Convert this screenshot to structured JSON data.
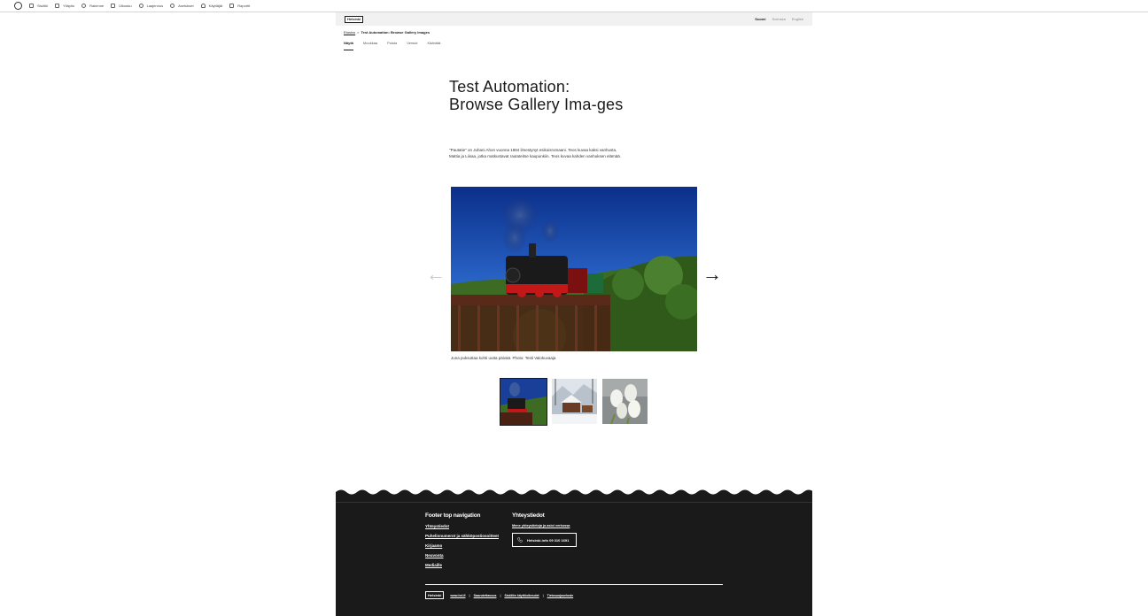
{
  "admin_bar": {
    "items": [
      {
        "label": "Sisältö",
        "icon": "content-icon"
      },
      {
        "label": "Ylläpito",
        "icon": "structure-icon"
      },
      {
        "label": "Rakenne",
        "icon": "gear-icon"
      },
      {
        "label": "Ulkoasu",
        "icon": "appearance-icon"
      },
      {
        "label": "Laajennus",
        "icon": "extend-icon"
      },
      {
        "label": "Asetukset",
        "icon": "config-icon"
      },
      {
        "label": "Käyttäjät",
        "icon": "people-icon"
      },
      {
        "label": "Raportit",
        "icon": "reports-icon"
      }
    ]
  },
  "header": {
    "logo": "Helsinki",
    "languages": [
      "Suomi",
      "Svenska",
      "English"
    ],
    "active_language": "Suomi"
  },
  "breadcrumb": {
    "home": "Etusivu",
    "separator": ">",
    "current": "Test Automation: Browse Gallery Images"
  },
  "local_tabs": [
    "Näytä",
    "Muokkaa",
    "Poista",
    "Versiot",
    "Kääntää"
  ],
  "page": {
    "title": "Test Automation: Browse Gallery Ima-ges",
    "lead": "\"Pautatie\" on Juhani Ahon vuonna 1884 ilmestynyt esikoisromaani. Teos kuvaa kaksi vanhusta, Mattia ja Liisaa, jotka matkustavat rautateitse kaupunkiin. Teos kuvaa kahden vanhuksen elämää."
  },
  "gallery": {
    "caption": "Juna puksuttaa kohti uutta päivää. Photo: Testi Valokuvaaja",
    "prev_label": "←",
    "next_label": "→",
    "thumbnails": [
      "train",
      "winter-village",
      "tulips"
    ],
    "active_index": 0
  },
  "footer": {
    "nav_heading": "Footer top navigation",
    "nav_links": [
      "Yhteystiedot",
      "Puhelinnumerot ja sähköpostiosoitteet",
      "Kirjaamo",
      "Neuvonta",
      "Mediaille"
    ],
    "contact_heading": "Yhteystiedot",
    "contact_link": "Mene yhteystietoja ja asioi verkossa",
    "phone_label": "Helsinki-info 09 310 1691",
    "logo": "Helsinki",
    "bottom_links": [
      "www.hel.fi",
      "Saavutettavuus",
      "Sisällön käyttöoikeudet",
      "Tietosuojaseloste"
    ]
  },
  "colors": {
    "footer_bg": "#1a1a1a",
    "header_bg": "#f1f1f1",
    "text": "#1a1a1a"
  }
}
